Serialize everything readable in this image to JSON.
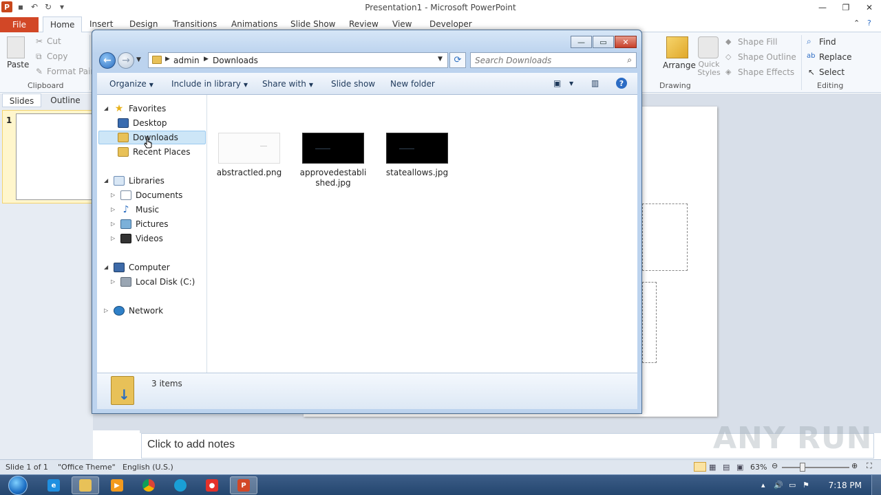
{
  "powerpoint": {
    "window_title": "Presentation1 - Microsoft PowerPoint",
    "qat": {
      "logo": "P"
    },
    "tabs": [
      {
        "label": "File"
      },
      {
        "label": "Home"
      },
      {
        "label": "Insert"
      },
      {
        "label": "Design"
      },
      {
        "label": "Transitions"
      },
      {
        "label": "Animations"
      },
      {
        "label": "Slide Show"
      },
      {
        "label": "Review"
      },
      {
        "label": "View"
      },
      {
        "label": "Developer"
      }
    ],
    "ribbon": {
      "paste": "Paste",
      "cut": "Cut",
      "copy": "Copy",
      "format_painter": "Format Painter",
      "clipboard_group": "Clipboard",
      "arrange": "Arrange",
      "quick_styles": "Quick Styles",
      "shape_fill": "Shape Fill",
      "shape_outline": "Shape Outline",
      "shape_effects": "Shape Effects",
      "drawing_group": "Drawing",
      "find": "Find",
      "replace": "Replace",
      "select": "Select",
      "editing_group": "Editing"
    },
    "panel_tabs": {
      "slides": "Slides",
      "outline": "Outline"
    },
    "slide_number": "1",
    "notes_placeholder": "Click to add notes",
    "status": {
      "slide": "Slide 1 of 1",
      "theme": "\"Office Theme\"",
      "language": "English (U.S.)",
      "zoom": "63%"
    },
    "watermark": "ANY RUN"
  },
  "explorer": {
    "breadcrumb": [
      "admin",
      "Downloads"
    ],
    "search_placeholder": "Search Downloads",
    "commands": {
      "organize": "Organize",
      "include_in_library": "Include in library",
      "share_with": "Share with",
      "slide_show": "Slide show",
      "new_folder": "New folder"
    },
    "nav": {
      "favorites": "Favorites",
      "desktop": "Desktop",
      "downloads": "Downloads",
      "recent_places": "Recent Places",
      "libraries": "Libraries",
      "documents": "Documents",
      "music": "Music",
      "pictures": "Pictures",
      "videos": "Videos",
      "computer": "Computer",
      "local_disk": "Local Disk (C:)",
      "network": "Network"
    },
    "files": [
      {
        "name": "abstractled.png"
      },
      {
        "name": "approvedestablished.jpg"
      },
      {
        "name": "stateallows.jpg"
      }
    ],
    "item_count": "3 items"
  },
  "taskbar": {
    "clock": "7:18 PM"
  },
  "colors": {
    "file_tab": "#d24726",
    "selection": "#cde6f7",
    "taskbar": "#24466f"
  }
}
